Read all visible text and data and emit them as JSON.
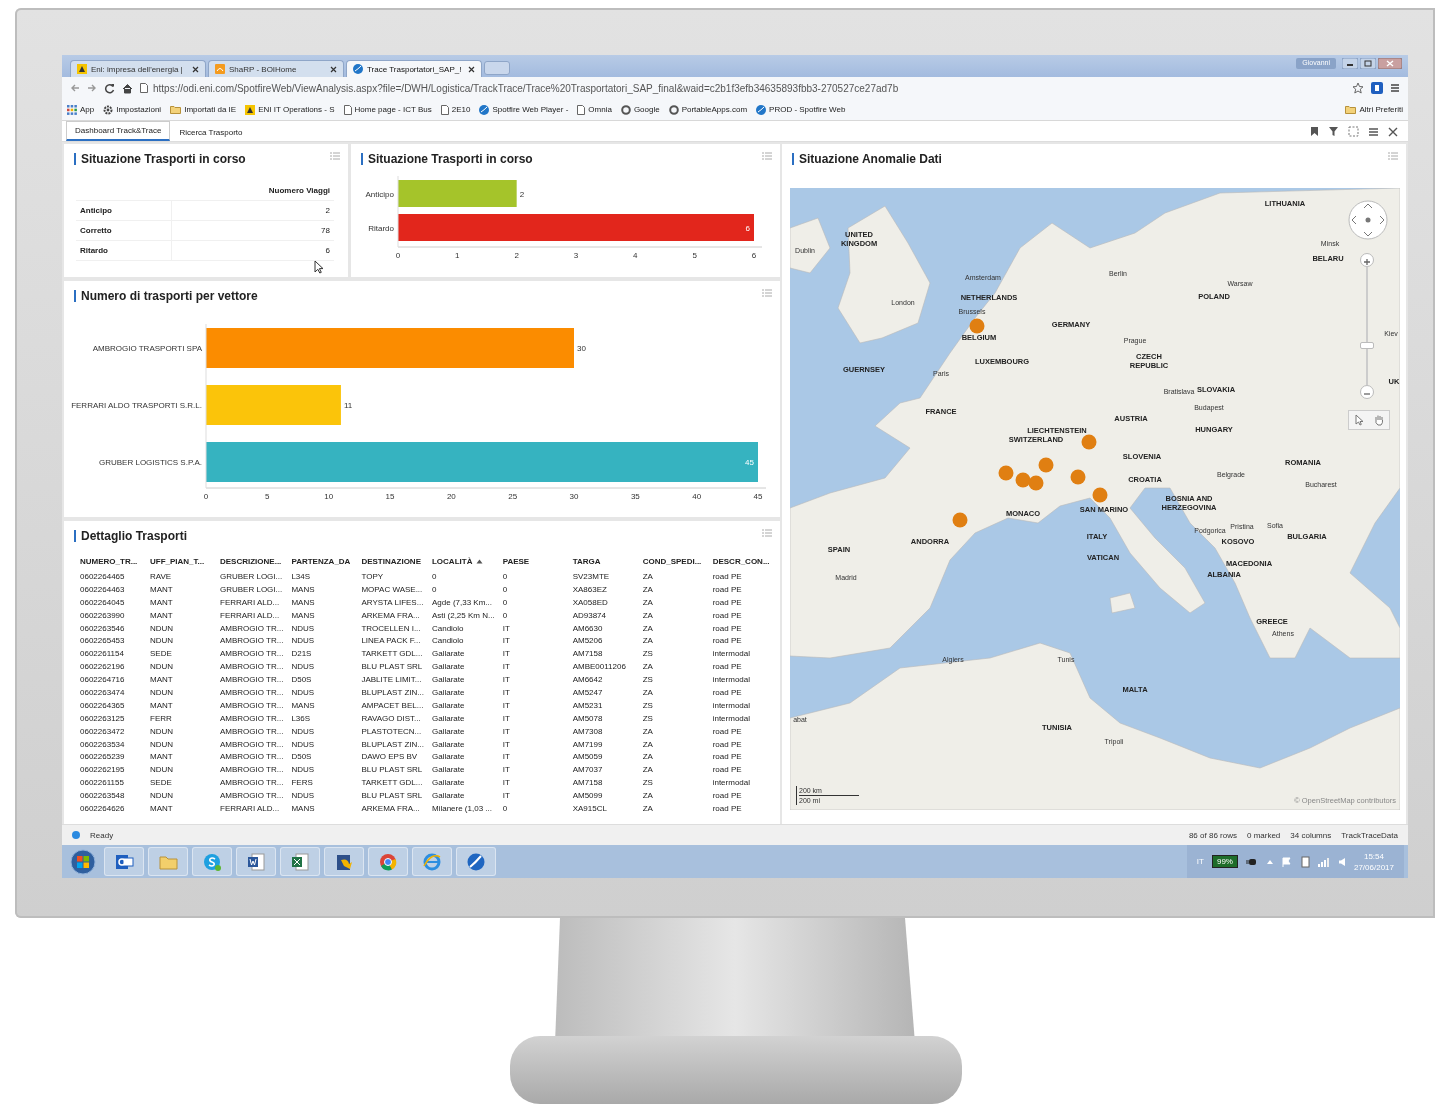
{
  "browser": {
    "tabs": [
      {
        "title": "Eni: impresa dell'energia |",
        "kind": "badge",
        "selected": false
      },
      {
        "title": "ShaRP - BOIHome",
        "kind": "tile",
        "selected": false
      },
      {
        "title": "Trace Trasportatori_SAP_!",
        "kind": "disc",
        "selected": true
      }
    ],
    "user": "Giovanni",
    "url": "https://odi.eni.com/SpotfireWeb/ViewAnalysis.aspx?file=/DWH/Logistica/TrackTrace/Trace%20Trasportatori_SAP_final&waid=c2b1f3efb34635893fbb3-270527ce27ad7b",
    "bookmarks": [
      {
        "label": "App",
        "kind": "apps"
      },
      {
        "label": "Impostazioni",
        "kind": "gear"
      },
      {
        "label": "Importati da IE",
        "kind": "folder"
      },
      {
        "label": "ENI IT Operations - S",
        "kind": "badge"
      },
      {
        "label": "Home page - ICT Bus",
        "kind": "page"
      },
      {
        "label": "2E10",
        "kind": "page"
      },
      {
        "label": "Spotfire Web Player -",
        "kind": "disc"
      },
      {
        "label": "Omnia",
        "kind": "page"
      },
      {
        "label": "Google",
        "kind": "ring"
      },
      {
        "label": "PortableApps.com",
        "kind": "ring"
      },
      {
        "label": "PROD - Spotfire Web",
        "kind": "disc"
      }
    ],
    "other_bookmarks": "Altri Preferiti"
  },
  "app_tabs": [
    {
      "label": "Dashboard Track&Trace",
      "selected": true
    },
    {
      "label": "Ricerca Trasporto",
      "selected": false
    }
  ],
  "summary_table": {
    "title": "Situazione Trasporti in corso",
    "column": "Nuomero Viaggi",
    "rows": [
      {
        "label": "Anticipo",
        "value": "2"
      },
      {
        "label": "Corretto",
        "value": "78"
      },
      {
        "label": "Ritardo",
        "value": "6"
      }
    ]
  },
  "status_chart": {
    "title": "Situazione Trasporti in corso",
    "chart_data": {
      "type": "bar",
      "orientation": "horizontal",
      "data_labels": true,
      "categories": [
        "Anticipo",
        "Ritardo"
      ],
      "series": [
        {
          "color": "#a5c42a",
          "values": [
            2,
            null
          ]
        },
        {
          "color": "#e2261c",
          "values": [
            null,
            6
          ]
        }
      ],
      "xlim": [
        0,
        6
      ],
      "xticks": [
        0,
        1,
        2,
        3,
        4,
        5,
        6
      ]
    }
  },
  "carrier_chart": {
    "title": "Numero di trasporti per vettore",
    "chart_data": {
      "type": "bar",
      "orientation": "horizontal",
      "data_labels": true,
      "categories": [
        "AMBROGIO TRASPORTI SPA",
        "FERRARI ALDO TRASPORTI S.R.L.",
        "GRUBER LOGISTICS S.P.A."
      ],
      "series": [
        {
          "color": "#fb8c00",
          "values": [
            30,
            null,
            null
          ]
        },
        {
          "color": "#fbc40a",
          "values": [
            null,
            11,
            null
          ]
        },
        {
          "color": "#36b3c0",
          "values": [
            null,
            null,
            45
          ]
        }
      ],
      "xlim": [
        0,
        45
      ],
      "xticks": [
        0,
        5,
        10,
        15,
        20,
        25,
        30,
        35,
        40,
        45
      ]
    }
  },
  "detail_table": {
    "title": "Dettaglio Trasporti",
    "columns": [
      {
        "label": "NUMERO_TR...",
        "sorted": false
      },
      {
        "label": "UFF_PIAN_T...",
        "sorted": false
      },
      {
        "label": "DESCRIZIONE...",
        "sorted": false
      },
      {
        "label": "PARTENZA_DA",
        "sorted": false
      },
      {
        "label": "DESTINAZIONE",
        "sorted": false
      },
      {
        "label": "LOCALITÀ",
        "sorted": true
      },
      {
        "label": "PAESE",
        "sorted": false
      },
      {
        "label": "TARGA",
        "sorted": false
      },
      {
        "label": "COND_SPEDI...",
        "sorted": false
      },
      {
        "label": "DESCR_CON...",
        "sorted": false
      }
    ],
    "rows": [
      [
        "0602264465",
        "RAVE",
        "GRUBER LOGI...",
        "L34S",
        "TOPY",
        "0",
        "0",
        "SV23MTE",
        "ZA",
        "road PE"
      ],
      [
        "0602264463",
        "MANT",
        "GRUBER LOGI...",
        "MANS",
        "MOPAC WASE...",
        "0",
        "0",
        "XA863EZ",
        "ZA",
        "road PE"
      ],
      [
        "0602264045",
        "MANT",
        "FERRARI ALD...",
        "MANS",
        "ARYSTA LIFES...",
        "Agde (7,33 Km...",
        "0",
        "XA058ED",
        "ZA",
        "road PE"
      ],
      [
        "0602263990",
        "MANT",
        "FERRARI ALD...",
        "MANS",
        "ARKEMA FRA...",
        "Asti (2,25 Km N...",
        "0",
        "AD93874",
        "ZA",
        "road PE"
      ],
      [
        "0602263546",
        "NDUN",
        "AMBROGIO TR...",
        "NDUS",
        "TROCELLEN I...",
        "Candiolo",
        "IT",
        "AM6630",
        "ZA",
        "road PE"
      ],
      [
        "0602265453",
        "NDUN",
        "AMBROGIO TR...",
        "NDUS",
        "LINEA PACK F...",
        "Candiolo",
        "IT",
        "AM5206",
        "ZA",
        "road PE"
      ],
      [
        "0602261154",
        "SEDE",
        "AMBROGIO TR...",
        "D21S",
        "TARKETT GDL...",
        "Gallarate",
        "IT",
        "AM7158",
        "ZS",
        "intermodal"
      ],
      [
        "0602262196",
        "NDUN",
        "AMBROGIO TR...",
        "NDUS",
        "BLU PLAST SRL",
        "Gallarate",
        "IT",
        "AMBE0011206",
        "ZA",
        "road PE"
      ],
      [
        "0602264716",
        "MANT",
        "AMBROGIO TR...",
        "D50S",
        "JABLITE LIMIT...",
        "Gallarate",
        "IT",
        "AM6642",
        "ZS",
        "intermodal"
      ],
      [
        "0602263474",
        "NDUN",
        "AMBROGIO TR...",
        "NDUS",
        "BLUPLAST ZIN...",
        "Gallarate",
        "IT",
        "AM5247",
        "ZA",
        "road PE"
      ],
      [
        "0602264365",
        "MANT",
        "AMBROGIO TR...",
        "MANS",
        "AMPACET BEL...",
        "Gallarate",
        "IT",
        "AM5231",
        "ZS",
        "intermodal"
      ],
      [
        "0602263125",
        "FERR",
        "AMBROGIO TR...",
        "L36S",
        "RAVAGO DIST...",
        "Gallarate",
        "IT",
        "AM5078",
        "ZS",
        "intermodal"
      ],
      [
        "0602263472",
        "NDUN",
        "AMBROGIO TR...",
        "NDUS",
        "PLASTOTECN...",
        "Gallarate",
        "IT",
        "AM7308",
        "ZA",
        "road PE"
      ],
      [
        "0602263534",
        "NDUN",
        "AMBROGIO TR...",
        "NDUS",
        "BLUPLAST ZIN...",
        "Gallarate",
        "IT",
        "AM7199",
        "ZA",
        "road PE"
      ],
      [
        "0602265239",
        "MANT",
        "AMBROGIO TR...",
        "D50S",
        "DAWO EPS BV",
        "Gallarate",
        "IT",
        "AM5059",
        "ZA",
        "road PE"
      ],
      [
        "0602262195",
        "NDUN",
        "AMBROGIO TR...",
        "NDUS",
        "BLU PLAST SRL",
        "Gallarate",
        "IT",
        "AM7037",
        "ZA",
        "road PE"
      ],
      [
        "0602261155",
        "SEDE",
        "AMBROGIO TR...",
        "FERS",
        "TARKETT GDL...",
        "Gallarate",
        "IT",
        "AM7158",
        "ZS",
        "intermodal"
      ],
      [
        "0602263548",
        "NDUN",
        "AMBROGIO TR...",
        "NDUS",
        "BLU PLAST SRL",
        "Gallarate",
        "IT",
        "AM5099",
        "ZA",
        "road PE"
      ],
      [
        "0602264626",
        "MANT",
        "FERRARI ALD...",
        "MANS",
        "ARKEMA FRA...",
        "Milanere (1,03 ...",
        "0",
        "XA915CL",
        "ZA",
        "road PE"
      ]
    ]
  },
  "map": {
    "title": "Situazione Anomalie Dati",
    "labels": [
      {
        "text": "Dublin",
        "kind": "city"
      },
      {
        "text": "UNITED KINGDOM",
        "kind": "country"
      },
      {
        "text": "Amsterdam",
        "kind": "city"
      },
      {
        "text": "NETHERLANDS",
        "kind": "country"
      },
      {
        "text": "London",
        "kind": "city"
      },
      {
        "text": "Brussels",
        "kind": "city"
      },
      {
        "text": "BELGIUM",
        "kind": "country"
      },
      {
        "text": "LUXEMBOURG",
        "kind": "country"
      },
      {
        "text": "GERMANY",
        "kind": "country"
      },
      {
        "text": "Berlin",
        "kind": "city"
      },
      {
        "text": "GUERNSEY",
        "kind": "country"
      },
      {
        "text": "Paris",
        "kind": "city"
      },
      {
        "text": "FRANCE",
        "kind": "country"
      },
      {
        "text": "Prague",
        "kind": "city"
      },
      {
        "text": "CZECH REPUBLIC",
        "kind": "country"
      },
      {
        "text": "LITHUANIA",
        "kind": "country"
      },
      {
        "text": "Minsk",
        "kind": "city"
      },
      {
        "text": "BELARU",
        "kind": "country"
      },
      {
        "text": "UK",
        "kind": "country"
      },
      {
        "text": "Warsaw",
        "kind": "city"
      },
      {
        "text": "POLAND",
        "kind": "country"
      },
      {
        "text": "Kiev",
        "kind": "city"
      },
      {
        "text": "Bratislava",
        "kind": "city"
      },
      {
        "text": "SLOVAKIA",
        "kind": "country"
      },
      {
        "text": "Budapest",
        "kind": "city"
      },
      {
        "text": "HUNGARY",
        "kind": "country"
      },
      {
        "text": "AUSTRIA",
        "kind": "country"
      },
      {
        "text": "LIECHTENSTEIN",
        "kind": "country"
      },
      {
        "text": "SWITZERLAND",
        "kind": "country"
      },
      {
        "text": "SLOVENIA",
        "kind": "country"
      },
      {
        "text": "CROATIA",
        "kind": "country"
      },
      {
        "text": "ROMANIA",
        "kind": "country"
      },
      {
        "text": "Belgrade",
        "kind": "city"
      },
      {
        "text": "Bucharest",
        "kind": "city"
      },
      {
        "text": "BOSNIA AND HERZEGOVINA",
        "kind": "country"
      },
      {
        "text": "SAN MARINO",
        "kind": "country"
      },
      {
        "text": "MONACO",
        "kind": "country"
      },
      {
        "text": "ANDORRA",
        "kind": "country"
      },
      {
        "text": "SPAIN",
        "kind": "country"
      },
      {
        "text": "ITALY",
        "kind": "country"
      },
      {
        "text": "VATICAN",
        "kind": "country"
      },
      {
        "text": "Podgorica",
        "kind": "city"
      },
      {
        "text": "Pristina",
        "kind": "city"
      },
      {
        "text": "Sofia",
        "kind": "city"
      },
      {
        "text": "KOSOVO",
        "kind": "country"
      },
      {
        "text": "BULGARIA",
        "kind": "country"
      },
      {
        "text": "MACEDONIA",
        "kind": "country"
      },
      {
        "text": "ALBANIA",
        "kind": "country"
      },
      {
        "text": "Madrid",
        "kind": "city"
      },
      {
        "text": "GREECE",
        "kind": "country"
      },
      {
        "text": "Athens",
        "kind": "city"
      },
      {
        "text": "Algiers",
        "kind": "city"
      },
      {
        "text": "Tunis",
        "kind": "city"
      },
      {
        "text": "MALTA",
        "kind": "country"
      },
      {
        "text": "TUNISIA",
        "kind": "country"
      },
      {
        "text": "Tripoli",
        "kind": "city"
      },
      {
        "text": "abat",
        "kind": "city"
      }
    ],
    "zoom": {
      "level": 0.32
    },
    "scale_km": "200 km",
    "scale_mi": "200 mi",
    "attribution": "© OpenStreetMap contributors"
  },
  "status_bar": {
    "status": "Ready",
    "rows": "86 of 86 rows",
    "marked": "0 marked",
    "columns": "34 columns",
    "table": "TrackTraceData"
  },
  "taskbar": {
    "language": "IT",
    "battery": "99%",
    "time": "15:54",
    "date": "27/06/2017"
  }
}
